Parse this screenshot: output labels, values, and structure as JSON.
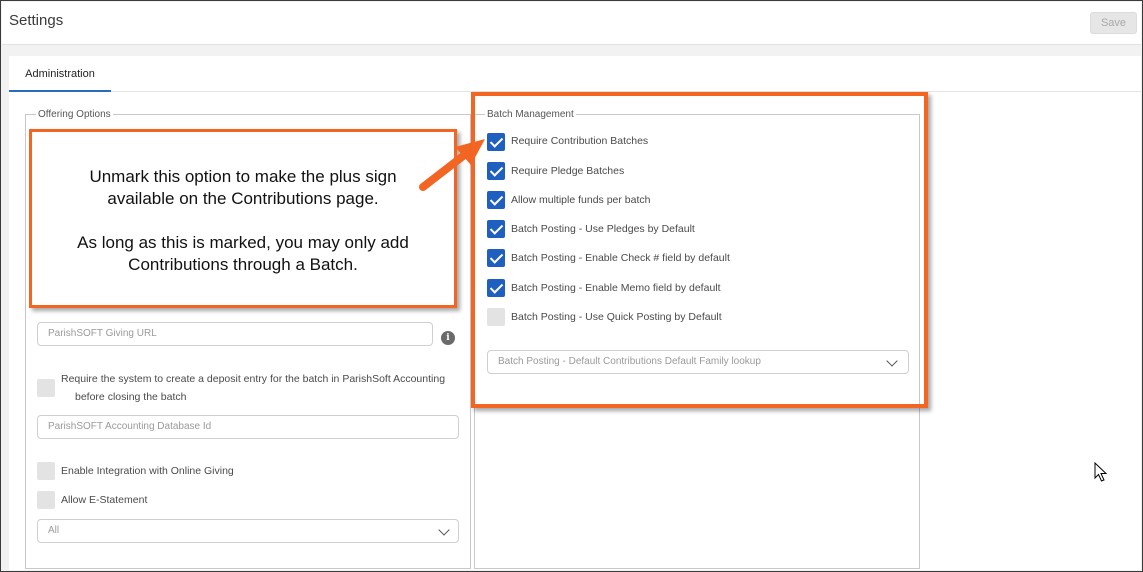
{
  "header": {
    "title": "Settings",
    "save_label": "Save"
  },
  "tabs": [
    {
      "label": "Administration",
      "active": true
    }
  ],
  "offering_options": {
    "legend": "Offering Options",
    "giving_url_placeholder": "ParishSOFT Giving URL",
    "info_icon": "i",
    "deposit_entry_label_line1": "Require the system to create a deposit entry for the batch in ParishSoft Accounting",
    "deposit_entry_label_line2": "before closing the batch",
    "deposit_entry_checked": false,
    "accounting_db_placeholder": "ParishSOFT Accounting Database Id",
    "online_giving_label": "Enable Integration with Online Giving",
    "online_giving_checked": false,
    "estatement_label": "Allow E-Statement",
    "estatement_checked": false,
    "select_value": "All"
  },
  "batch_management": {
    "legend": "Batch Management",
    "items": [
      {
        "label": "Require Contribution Batches",
        "checked": true
      },
      {
        "label": "Require Pledge Batches",
        "checked": true
      },
      {
        "label": "Allow multiple funds per batch",
        "checked": true
      },
      {
        "label": "Batch Posting - Use Pledges by Default",
        "checked": true
      },
      {
        "label": "Batch Posting - Enable Check # field by default",
        "checked": true
      },
      {
        "label": "Batch Posting - Enable Memo field by default",
        "checked": true
      },
      {
        "label": "Batch Posting - Use Quick Posting by Default",
        "checked": false
      }
    ],
    "family_lookup_placeholder": "Batch Posting - Default Contributions Default Family lookup"
  },
  "callout": {
    "line1": "Unmark this option to make the plus sign",
    "line2": "available on the Contributions page.",
    "line3": "As long as this is marked, you may only add",
    "line4": "Contributions through a Batch."
  },
  "colors": {
    "accent": "#f26522",
    "checkbox": "#1f5fc0",
    "tab_underline": "#2a6bbf"
  }
}
